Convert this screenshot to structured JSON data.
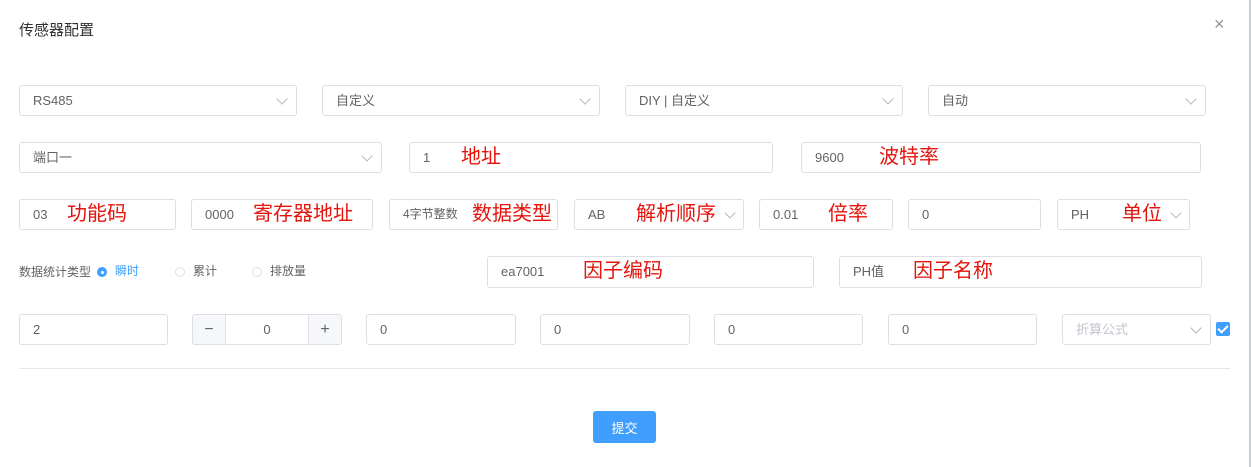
{
  "dialog": {
    "title": "传感器配置",
    "close_symbol": "×"
  },
  "row1": {
    "interface": "RS485",
    "protocol": "自定义",
    "device_type": "DIY | 自定义",
    "mode": "自动"
  },
  "row2": {
    "port": "端口一",
    "address": "1",
    "address_note": "地址",
    "baud_rate": "9600",
    "baud_rate_note": "波特率"
  },
  "row3": {
    "function_code": "03",
    "function_code_note": "功能码",
    "register_address": "0000",
    "register_address_note": "寄存器地址",
    "data_type": "4字节整数",
    "data_type_note": "数据类型",
    "parse_order": "AB",
    "parse_order_note": "解析顺序",
    "multiplier": "0.01",
    "multiplier_note": "倍率",
    "offset": "0",
    "unit": "PH",
    "unit_note": "单位"
  },
  "row4": {
    "stat_label": "数据统计类型",
    "options": [
      "瞬时",
      "累计",
      "排放量"
    ],
    "selected": "瞬时",
    "factor_code": "ea7001",
    "factor_code_note": "因子编码",
    "factor_name": "PH值",
    "factor_name_note": "因子名称"
  },
  "row5": {
    "precision": "2",
    "stepper_value": "0",
    "stepper_minus": "−",
    "stepper_plus": "+",
    "v1": "0",
    "v2": "0",
    "v3": "0",
    "v4": "0",
    "formula_placeholder": "折算公式",
    "enabled_checked": true
  },
  "footer": {
    "submit_label": "提交"
  },
  "colors": {
    "primary": "#409eff",
    "annotation": "#e4140d",
    "border": "#dcdfe6"
  },
  "icons": [
    "close-icon",
    "chevron-down-icon",
    "minus-icon",
    "plus-icon",
    "check-icon",
    "radio-dot-icon"
  ]
}
